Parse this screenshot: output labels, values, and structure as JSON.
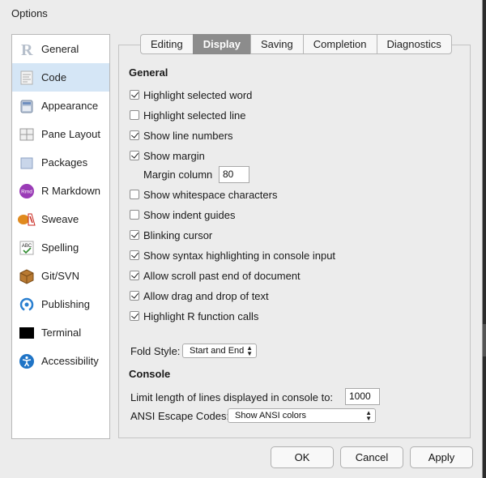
{
  "window": {
    "title": "Options"
  },
  "sidebar": {
    "items": [
      {
        "label": "General",
        "icon": "r-logo-icon"
      },
      {
        "label": "Code",
        "icon": "code-icon",
        "selected": true
      },
      {
        "label": "Appearance",
        "icon": "appearance-icon"
      },
      {
        "label": "Pane Layout",
        "icon": "pane-layout-icon"
      },
      {
        "label": "Packages",
        "icon": "packages-icon"
      },
      {
        "label": "R Markdown",
        "icon": "rmd-icon"
      },
      {
        "label": "Sweave",
        "icon": "sweave-icon"
      },
      {
        "label": "Spelling",
        "icon": "spelling-icon"
      },
      {
        "label": "Git/SVN",
        "icon": "git-icon"
      },
      {
        "label": "Publishing",
        "icon": "publishing-icon"
      },
      {
        "label": "Terminal",
        "icon": "terminal-icon"
      },
      {
        "label": "Accessibility",
        "icon": "accessibility-icon"
      }
    ],
    "icon_text": {
      "rmd": "Rmd",
      "spelling": "ABC"
    }
  },
  "tabs": [
    {
      "label": "Editing"
    },
    {
      "label": "Display",
      "active": true
    },
    {
      "label": "Saving"
    },
    {
      "label": "Completion"
    },
    {
      "label": "Diagnostics"
    }
  ],
  "general": {
    "title": "General",
    "options": [
      {
        "label": "Highlight selected word",
        "checked": true
      },
      {
        "label": "Highlight selected line",
        "checked": false
      },
      {
        "label": "Show line numbers",
        "checked": true
      },
      {
        "label": "Show margin",
        "checked": true
      },
      {
        "label": "Show whitespace characters",
        "checked": false
      },
      {
        "label": "Show indent guides",
        "checked": false
      },
      {
        "label": "Blinking cursor",
        "checked": true
      },
      {
        "label": "Show syntax highlighting in console input",
        "checked": true
      },
      {
        "label": "Allow scroll past end of document",
        "checked": true
      },
      {
        "label": "Allow drag and drop of text",
        "checked": true
      },
      {
        "label": "Highlight R function calls",
        "checked": true
      }
    ],
    "margin_column_label": "Margin column",
    "margin_column_value": "80",
    "fold_style_label": "Fold Style:",
    "fold_style_value": "Start and End"
  },
  "console": {
    "title": "Console",
    "limit_label": "Limit length of lines displayed in console to:",
    "limit_value": "1000",
    "ansi_label": "ANSI Escape Codes:",
    "ansi_value": "Show ANSI colors"
  },
  "buttons": {
    "ok": "OK",
    "cancel": "Cancel",
    "apply": "Apply"
  },
  "colors": {
    "selected_bg": "#d5e6f6",
    "active_tab": "#8c8c8c"
  }
}
